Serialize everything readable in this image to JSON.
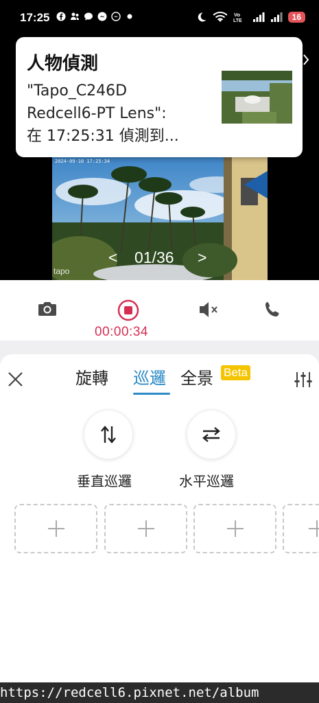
{
  "status_bar": {
    "time": "17:25",
    "left_icons": [
      "facebook-icon",
      "messenger-people-icon",
      "chat-bubble-icon",
      "messenger-icon",
      "messenger-icon",
      "dot-icon"
    ],
    "right_icons": [
      "moon-icon",
      "wifi-icon",
      "volte-lte-icon",
      "signal-icon",
      "signal-icon"
    ],
    "battery": "16"
  },
  "notification": {
    "title": "人物偵測",
    "body_line1": "\"Tapo_C246D",
    "body_line2": "Redcell6-PT Lens\":",
    "body_line3": "在 17:25:31 偵測到..."
  },
  "video": {
    "overlay_timestamp": "2024-09-10 17:25:34",
    "brand_mark": "tapo",
    "pager_prev": "<",
    "pager_next": ">",
    "pager_count": "01/36"
  },
  "controls": {
    "record_time": "00:00:34",
    "accent_red": "#d62e51"
  },
  "sheet": {
    "tabs": [
      {
        "label": "旋轉",
        "active": false
      },
      {
        "label": "巡邏",
        "active": true
      },
      {
        "label": "全景",
        "active": false
      }
    ],
    "beta_badge": "Beta",
    "accent_blue": "#2c8bc5",
    "patrol_buttons": [
      {
        "label": "垂直巡邏",
        "icon": "vertical-arrows-icon"
      },
      {
        "label": "水平巡邏",
        "icon": "horizontal-arrows-icon"
      }
    ],
    "preset_slots": [
      "add-icon",
      "add-icon",
      "add-icon",
      "add-icon"
    ]
  },
  "watermark": "https://redcell6.pixnet.net/album"
}
